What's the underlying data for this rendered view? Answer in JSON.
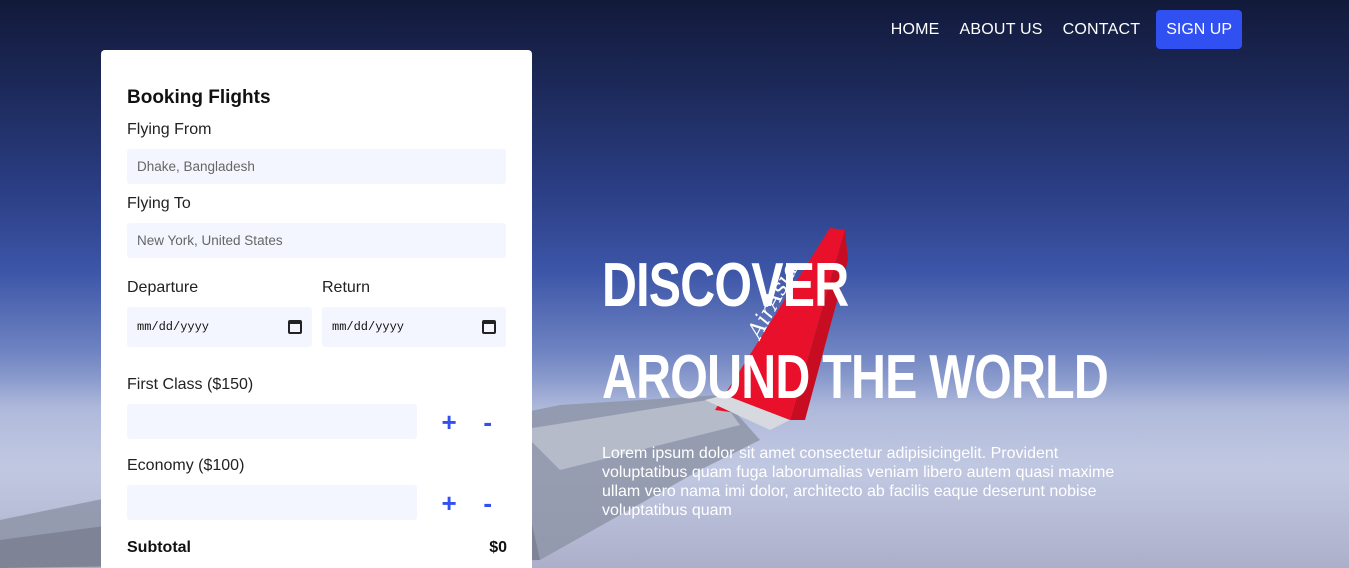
{
  "nav": {
    "home": "HOME",
    "about": "ABOUT US",
    "contact": "CONTACT",
    "signup": "SIGN UP"
  },
  "booking": {
    "title": "Booking Flights",
    "from_label": "Flying From",
    "from_placeholder": "Dhake, Bangladesh",
    "to_label": "Flying To",
    "to_placeholder": "New York, United States",
    "departure_label": "Departure",
    "return_label": "Return",
    "date_placeholder": "mm/dd/yyyy",
    "first_class_label": "First Class ($150)",
    "economy_label": "Economy ($100)",
    "plus": "+",
    "minus": "-",
    "subtotal_label": "Subtotal",
    "subtotal_value": "$0"
  },
  "hero": {
    "line1": "DISCOVER",
    "line2": "AROUND THE WORLD",
    "description": "Lorem ipsum dolor sit amet consectetur adipisicingelit. Provident voluptatibus quam fuga laborumalias veniam libero autem quasi maxime ullam vero nama imi dolor, architecto ab facilis eaque deserunt nobise voluptatibus quam"
  },
  "colors": {
    "accent": "#3150f2",
    "field_bg": "#f3f6fe",
    "tail_red": "#e8102a"
  },
  "icons": {
    "date": "calendar-icon"
  }
}
